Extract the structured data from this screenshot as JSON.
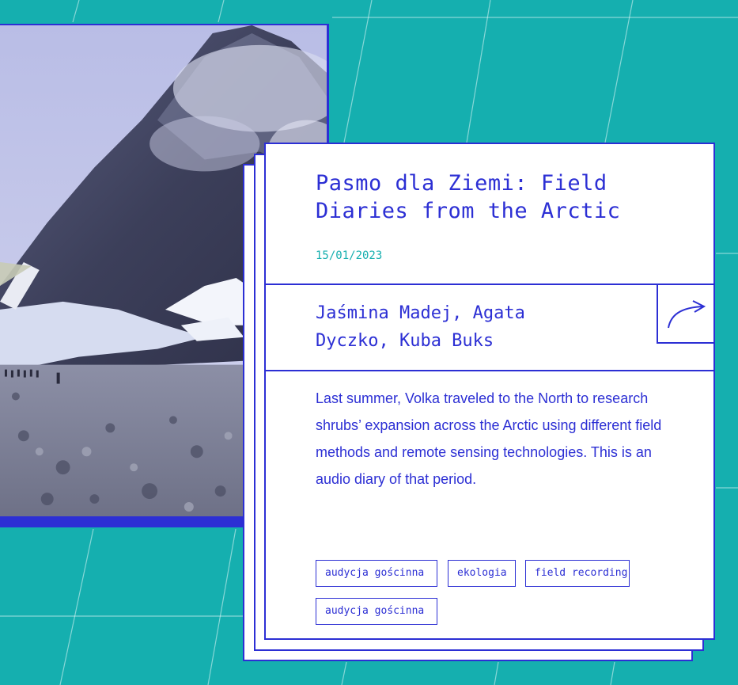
{
  "post": {
    "title": "Pasmo dla Ziemi: Field Diaries from the Arctic",
    "date": "15/01/2023",
    "authors": "Jaśmina Madej, Agata Dyczko, Kuba Buks",
    "description": "Last summer, Volka traveled to the North to research shrubs’ expansion across the Arctic using different field methods and remote sensing technologies. This is an audio diary of that period.",
    "tags": [
      "audycja gościnna",
      "ekologia",
      "field recording",
      "audycja gościnna"
    ],
    "share_icon": "arrow-curve-right-icon",
    "photo_subject": "glacier-mountain-hikers"
  },
  "colors": {
    "background": "#15afaf",
    "accent": "#2c2fd4",
    "date": "#15afaf",
    "card": "#ffffff"
  }
}
